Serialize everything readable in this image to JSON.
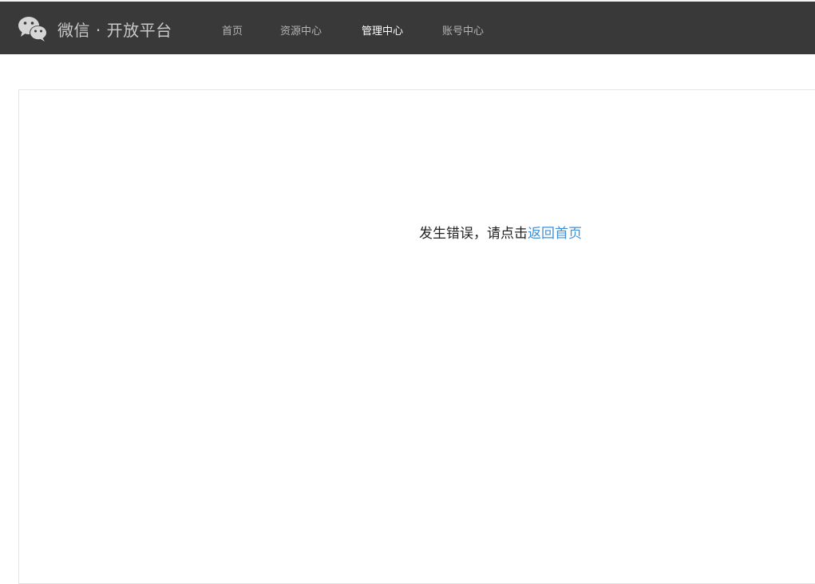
{
  "header": {
    "brand": "微信 · 开放平台",
    "logo_icon": "wechat-logo-icon",
    "nav": [
      {
        "label": "首页",
        "active": false
      },
      {
        "label": "资源中心",
        "active": false
      },
      {
        "label": "管理中心",
        "active": true
      },
      {
        "label": "账号中心",
        "active": false
      }
    ]
  },
  "main": {
    "error_message": "发生错误，请点击",
    "home_link": "返回首页"
  },
  "colors": {
    "header_bg": "#393939",
    "nav_text": "#b4b4b4",
    "nav_active": "#ffffff",
    "link": "#3e8fd8"
  }
}
